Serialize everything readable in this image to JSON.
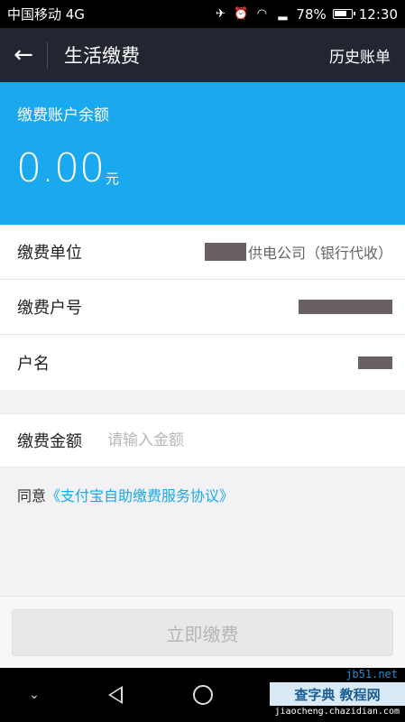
{
  "status_bar": {
    "carrier": "中国移动 4G",
    "battery": "78%",
    "time": "12:30"
  },
  "nav": {
    "title": "生活缴费",
    "action": "历史账单"
  },
  "balance": {
    "label": "缴费账户余额",
    "amount": "0.00",
    "unit": "元"
  },
  "info": [
    {
      "label": "缴费单位",
      "value": "供电公司（银行代收）"
    },
    {
      "label": "缴费户号",
      "value": ""
    },
    {
      "label": "户名",
      "value": ""
    }
  ],
  "amount": {
    "label": "缴费金额",
    "placeholder": "请输入金额"
  },
  "agreement": {
    "prefix": "同意",
    "link": "《支付宝自助缴费服务协议》"
  },
  "pay_button": "立即缴费",
  "watermark": {
    "top": "jb51.net",
    "main": "查字典 教程网",
    "sub": "jiaocheng.chazidian.com"
  }
}
